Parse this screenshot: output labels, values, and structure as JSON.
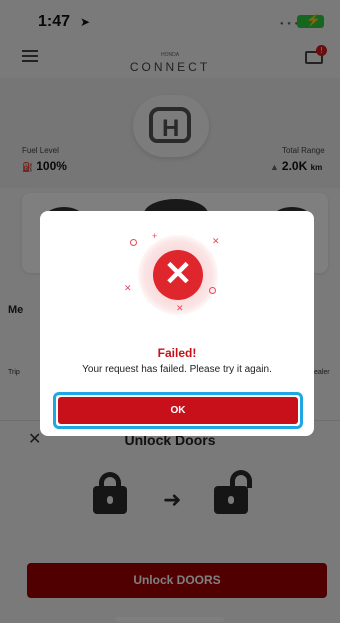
{
  "status_bar": {
    "time": "1:47",
    "location_icon": "location-arrow-icon",
    "battery_icon": "battery-charging-icon"
  },
  "header": {
    "brand_small": "HONDA",
    "brand_main": "CONNECT",
    "menu_icon": "hamburger-icon",
    "mail_icon": "mail-icon",
    "mail_badge": "!"
  },
  "vehicle": {
    "fuel_label": "Fuel Level",
    "fuel_value": "100%",
    "range_label": "Total Range",
    "range_value": "2.0K",
    "range_unit": "km"
  },
  "background": {
    "menu_label": "Me",
    "left_label": "Trip",
    "right_label": "ealer"
  },
  "sheet": {
    "title": "Unlock Doors",
    "close_icon": "close-icon",
    "button_label": "Unlock DOORS"
  },
  "dialog": {
    "icon": "error-x-icon",
    "title": "Failed!",
    "message": "Your request has failed. Please try it again.",
    "ok_label": "OK"
  },
  "colors": {
    "accent_red": "#c8101a",
    "highlight_blue": "#1ea7e2",
    "error_red": "#e0262d"
  }
}
